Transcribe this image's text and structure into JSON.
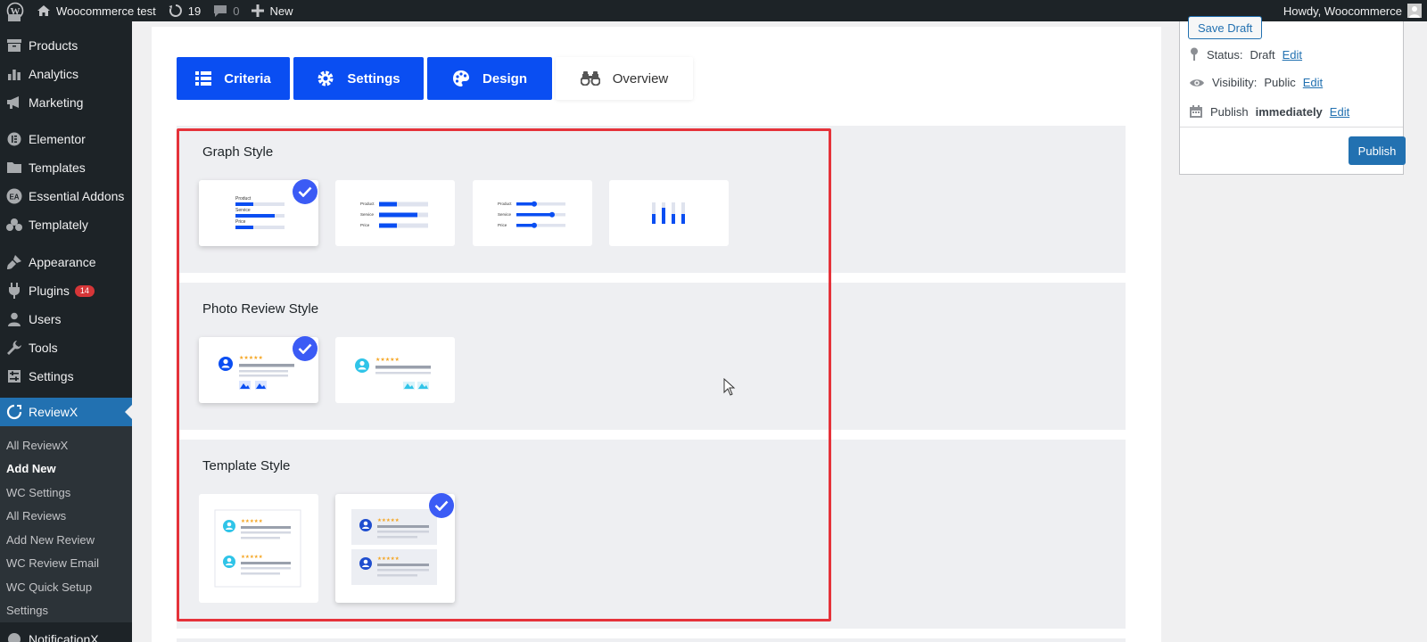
{
  "adminbar": {
    "site_name": "Woocommerce test",
    "updates_count": "19",
    "comments_count": "0",
    "new_label": "New",
    "howdy": "Howdy, Woocommerce"
  },
  "sidebar": {
    "items": [
      {
        "label": "Products",
        "icon": "archive-icon"
      },
      {
        "label": "Analytics",
        "icon": "bar-chart-icon"
      },
      {
        "label": "Marketing",
        "icon": "megaphone-icon"
      },
      {
        "label": "Elementor",
        "icon": "elementor-icon"
      },
      {
        "label": "Templates",
        "icon": "folder-icon"
      },
      {
        "label": "Essential Addons",
        "icon": "ea-icon"
      },
      {
        "label": "Templately",
        "icon": "templately-icon"
      },
      {
        "label": "Appearance",
        "icon": "brush-icon"
      },
      {
        "label": "Plugins",
        "icon": "plug-icon",
        "badge": "14"
      },
      {
        "label": "Users",
        "icon": "user-icon"
      },
      {
        "label": "Tools",
        "icon": "wrench-icon"
      },
      {
        "label": "Settings",
        "icon": "settings-icon"
      },
      {
        "label": "ReviewX",
        "icon": "reviewx-icon"
      }
    ],
    "submenu": [
      "All ReviewX",
      "Add New",
      "WC Settings",
      "All Reviews",
      "Add New Review",
      "WC Review Email",
      "WC Quick Setup",
      "Settings"
    ],
    "partial_item": "NotificationX"
  },
  "tabs": [
    {
      "label": "Criteria",
      "icon": "list-icon",
      "active": true
    },
    {
      "label": "Settings",
      "icon": "gear-icon",
      "active": true
    },
    {
      "label": "Design",
      "icon": "palette-icon",
      "active": true
    },
    {
      "label": "Overview",
      "icon": "binoculars-icon",
      "active": false
    }
  ],
  "sections": {
    "graph_style": {
      "title": "Graph Style",
      "selected_index": 0,
      "mini_labels": [
        "Product",
        "Service",
        "Price"
      ]
    },
    "photo_review_style": {
      "title": "Photo Review Style",
      "selected_index": 0
    },
    "template_style": {
      "title": "Template Style",
      "selected_index": 1
    }
  },
  "publish": {
    "save_draft": "Save Draft",
    "status_label": "Status:",
    "status_value": "Draft",
    "visibility_label": "Visibility:",
    "visibility_value": "Public",
    "publish_label": "Publish",
    "publish_value": "immediately",
    "edit": "Edit",
    "publish_button": "Publish"
  },
  "colors": {
    "accent": "#0a4ef2",
    "wp_blue": "#2271b1",
    "highlight": "#e5323a",
    "star": "#f5a623"
  }
}
